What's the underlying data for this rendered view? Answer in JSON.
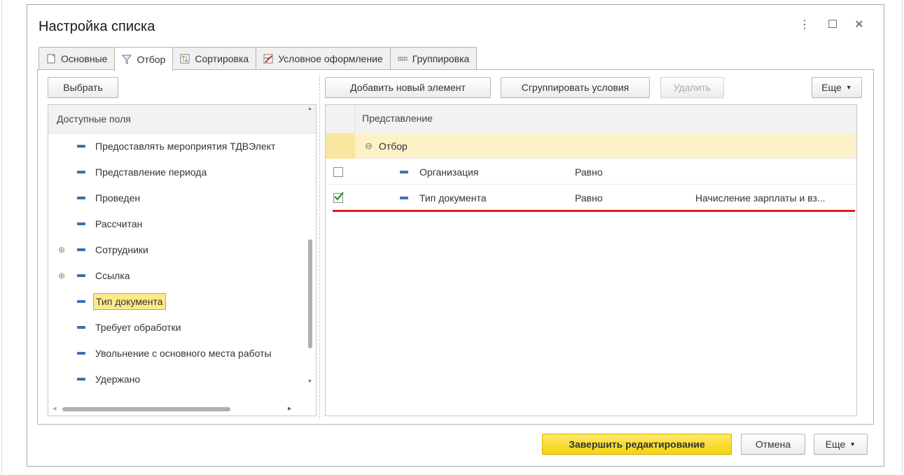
{
  "window": {
    "title": "Настройка списка"
  },
  "tabs": [
    {
      "label": "Основные",
      "icon": "document-icon"
    },
    {
      "label": "Отбор",
      "icon": "filter-icon"
    },
    {
      "label": "Сортировка",
      "icon": "sort-icon"
    },
    {
      "label": "Условное оформление",
      "icon": "conditional-format-icon"
    },
    {
      "label": "Группировка",
      "icon": "grouping-icon"
    }
  ],
  "toolbar": {
    "select_label": "Выбрать",
    "add_label": "Добавить новый элемент",
    "group_label": "Сгруппировать условия",
    "delete_label": "Удалить",
    "more_label": "Еще"
  },
  "available_fields": {
    "header": "Доступные поля",
    "items": [
      {
        "label": "Предоставлять мероприятия ТДВЭлект",
        "expandable": false,
        "selected": false
      },
      {
        "label": "Представление периода",
        "expandable": false,
        "selected": false
      },
      {
        "label": "Проведен",
        "expandable": false,
        "selected": false
      },
      {
        "label": "Рассчитан",
        "expandable": false,
        "selected": false
      },
      {
        "label": "Сотрудники",
        "expandable": true,
        "selected": false
      },
      {
        "label": "Ссылка",
        "expandable": true,
        "selected": false
      },
      {
        "label": "Тип документа",
        "expandable": false,
        "selected": true
      },
      {
        "label": "Требует обработки",
        "expandable": false,
        "selected": false
      },
      {
        "label": "Увольнение с основного места работы",
        "expandable": false,
        "selected": false
      },
      {
        "label": "Удержано",
        "expandable": false,
        "selected": false
      }
    ]
  },
  "filter_grid": {
    "header": "Представление",
    "group": {
      "label": "Отбор"
    },
    "rows": [
      {
        "field": "Организация",
        "condition": "Равно",
        "value": "",
        "checked": false
      },
      {
        "field": "Тип документа",
        "condition": "Равно",
        "value": "Начисление зарплаты и вз...",
        "checked": true
      }
    ]
  },
  "footer": {
    "finish_label": "Завершить редактирование",
    "cancel_label": "Отмена",
    "more_label": "Еще"
  },
  "colors": {
    "accent_yellow": "#f6d30a",
    "selection": "#fde98a",
    "group_row": "#fcf1c7",
    "check_green": "#2e9e2e",
    "underline_red": "#e21b1b"
  }
}
